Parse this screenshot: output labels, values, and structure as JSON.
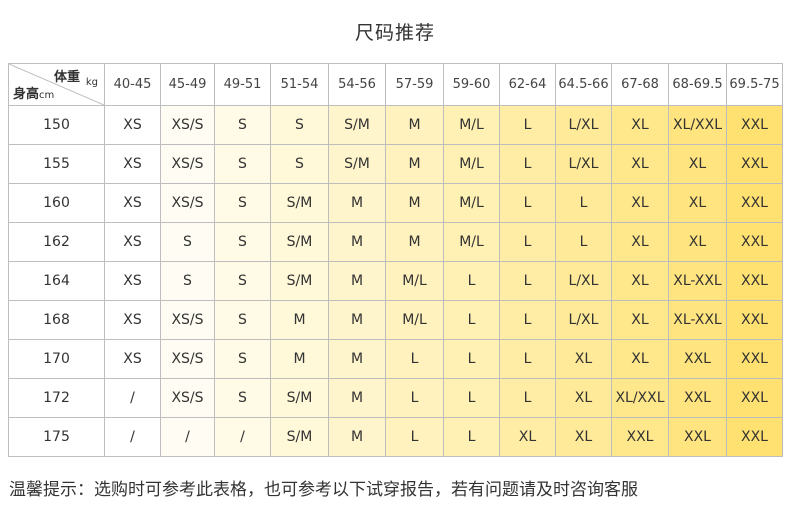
{
  "title": "尺码推荐",
  "header": {
    "weight_label": "体重",
    "weight_unit": "kg",
    "height_label": "身高",
    "height_unit": "cm"
  },
  "weight_ranges": [
    "40-45",
    "45-49",
    "49-51",
    "51-54",
    "54-56",
    "57-59",
    "59-60",
    "62-64",
    "64.5-66",
    "67-68",
    "68-69.5",
    "69.5-75"
  ],
  "column_colors": [
    "#ffffff",
    "#fffdf3",
    "#fffbe6",
    "#fff8d9",
    "#fff5cc",
    "#fff2bf",
    "#fff0b3",
    "#ffeda6",
    "#ffea99",
    "#ffe78c",
    "#ffe47f",
    "#ffe172"
  ],
  "rows": [
    {
      "height": "150",
      "sizes": [
        "XS",
        "XS/S",
        "S",
        "S",
        "S/M",
        "M",
        "M/L",
        "L",
        "L/XL",
        "XL",
        "XL/XXL",
        "XXL"
      ]
    },
    {
      "height": "155",
      "sizes": [
        "XS",
        "XS/S",
        "S",
        "S",
        "S/M",
        "M",
        "M/L",
        "L",
        "L/XL",
        "XL",
        "XL",
        "XXL"
      ]
    },
    {
      "height": "160",
      "sizes": [
        "XS",
        "XS/S",
        "S",
        "S/M",
        "M",
        "M",
        "M/L",
        "L",
        "L",
        "XL",
        "XL",
        "XXL"
      ]
    },
    {
      "height": "162",
      "sizes": [
        "XS",
        "S",
        "S",
        "S/M",
        "M",
        "M",
        "M/L",
        "L",
        "L",
        "XL",
        "XL",
        "XXL"
      ]
    },
    {
      "height": "164",
      "sizes": [
        "XS",
        "S",
        "S",
        "S/M",
        "M",
        "M/L",
        "L",
        "L",
        "L/XL",
        "XL",
        "XL-XXL",
        "XXL"
      ]
    },
    {
      "height": "168",
      "sizes": [
        "XS",
        "XS/S",
        "S",
        "M",
        "M",
        "M/L",
        "L",
        "L",
        "L/XL",
        "XL",
        "XL-XXL",
        "XXL"
      ]
    },
    {
      "height": "170",
      "sizes": [
        "XS",
        "XS/S",
        "S",
        "M",
        "M",
        "L",
        "L",
        "L",
        "XL",
        "XL",
        "XXL",
        "XXL"
      ]
    },
    {
      "height": "172",
      "sizes": [
        "/",
        "XS/S",
        "S",
        "S/M",
        "M",
        "L",
        "L",
        "L",
        "XL",
        "XL/XXL",
        "XXL",
        "XXL"
      ]
    },
    {
      "height": "175",
      "sizes": [
        "/",
        "/",
        "/",
        "S/M",
        "M",
        "L",
        "L",
        "XL",
        "XL",
        "XXL",
        "XXL",
        "XXL"
      ]
    }
  ],
  "footnote": "温馨提示：选购时可参考此表格，也可参考以下试穿报告，若有问题请及时咨询客服"
}
